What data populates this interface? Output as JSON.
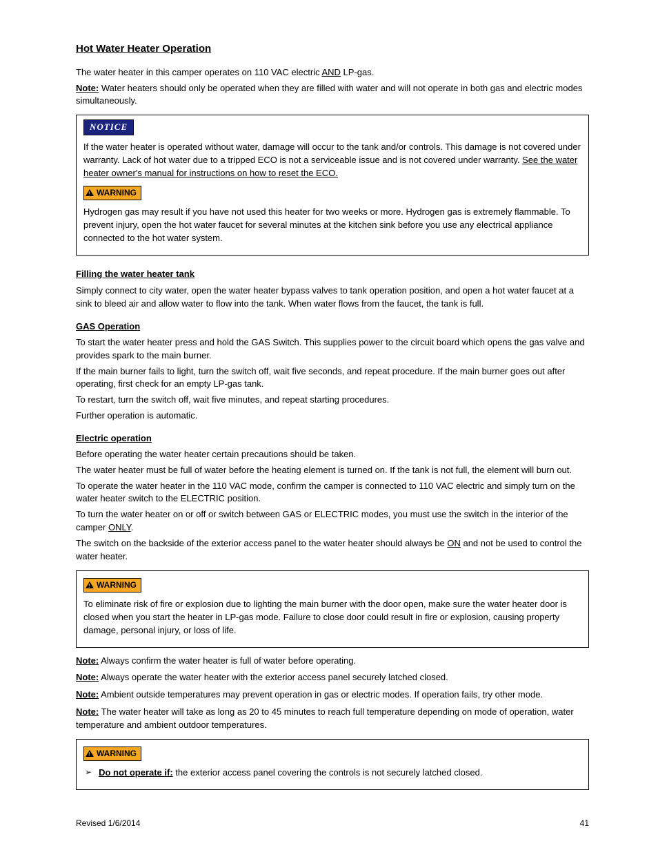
{
  "h1": "Hot Water Heater Operation",
  "intro": {
    "p1a": "The water heater in this camper operates on 110 VAC electric ",
    "p1_and": "AND",
    "p1b": " LP-gas.",
    "note_label": "Note:",
    "note_text": " Water heaters should only be operated when they are filled with water and will not operate in both gas and electric modes simultaneously."
  },
  "box1": {
    "notice_label": "NOTICE",
    "notice_text_a": "If the water heater is operated without water, damage will occur to the tank and/or controls. This damage is not covered under warranty. Lack of hot water due to a tripped ECO is not a serviceable issue and is not covered under warranty. ",
    "notice_text_b": "See the water heater owner's manual for instructions on how to reset the ECO.",
    "warning_label": "WARNING",
    "warning_text": "Hydrogen gas may result if you have not used this heater for two weeks or more. Hydrogen gas is extremely flammable. To prevent injury, open the hot water faucet for several minutes at the kitchen sink before you use any electrical appliance connected to the hot water system."
  },
  "h2_fill": "Filling the water heater tank",
  "fill_text": "Simply connect to city water, open the water heater bypass valves to tank operation position, and open a hot water faucet at a sink to bleed air and allow water to flow into the tank. When water flows from the faucet, the tank is full.",
  "h3_gas": "GAS Operation",
  "gas": {
    "p1": "To start the water heater press and hold the GAS Switch. This supplies power to the circuit board which opens the gas valve and provides spark to the main burner.",
    "p2": "If the main burner fails to light, turn the switch off, wait five seconds, and repeat procedure. If the main burner goes out after operating, first check for an empty LP-gas tank.",
    "p3": "To restart, turn the switch off, wait five minutes, and repeat starting procedures.",
    "p4": "Further operation is automatic."
  },
  "h3_elec": "Electric operation",
  "elec": {
    "p1": "Before operating the water heater certain precautions should be taken.",
    "p2": "The water heater must be full of water before the heating element is turned on. If the tank is not full, the element will burn out.",
    "p3": "To operate the water heater in the 110 VAC mode, confirm the camper is connected to 110 VAC electric and simply turn on the water heater switch to the ELECTRIC position.",
    "p4a": "To turn the water heater on or off or switch between GAS or ELECTRIC modes, you must use the switch in the interior of the camper ",
    "p4_only": "ONLY",
    "p4b": ".",
    "p5a": "The switch on the backside of the exterior access panel to the water heater should always be ",
    "p5_on": "ON",
    "p5b": " and not be used to control the water heater."
  },
  "box2": {
    "warning_label": "WARNING",
    "warning_text": "To eliminate risk of fire or explosion due to lighting the main burner with the door open, make sure the water heater door is closed when you start the heater in LP-gas mode. Failure to close door could result in fire or explosion, causing property damage, personal injury, or loss of life."
  },
  "notes": {
    "label": "Note:",
    "n1": " Always confirm the water heater is full of water before operating.",
    "n2": " Always operate the water heater with the exterior access panel securely latched closed.",
    "n3": " Ambient outside temperatures may prevent operation in gas or electric modes. If operation fails, try other mode.",
    "n4": " The water heater will take as long as 20 to 45 minutes to reach full temperature depending on mode of operation, water temperature and ambient outdoor temperatures."
  },
  "box3": {
    "warning_label": "WARNING",
    "bullet_glyph": "➢",
    "bullet_label": "Do not operate if:",
    "bullet_text": " the exterior access panel covering the controls is not securely latched closed."
  },
  "footer": {
    "left": "Revised 1/6/2014",
    "right": "41"
  }
}
